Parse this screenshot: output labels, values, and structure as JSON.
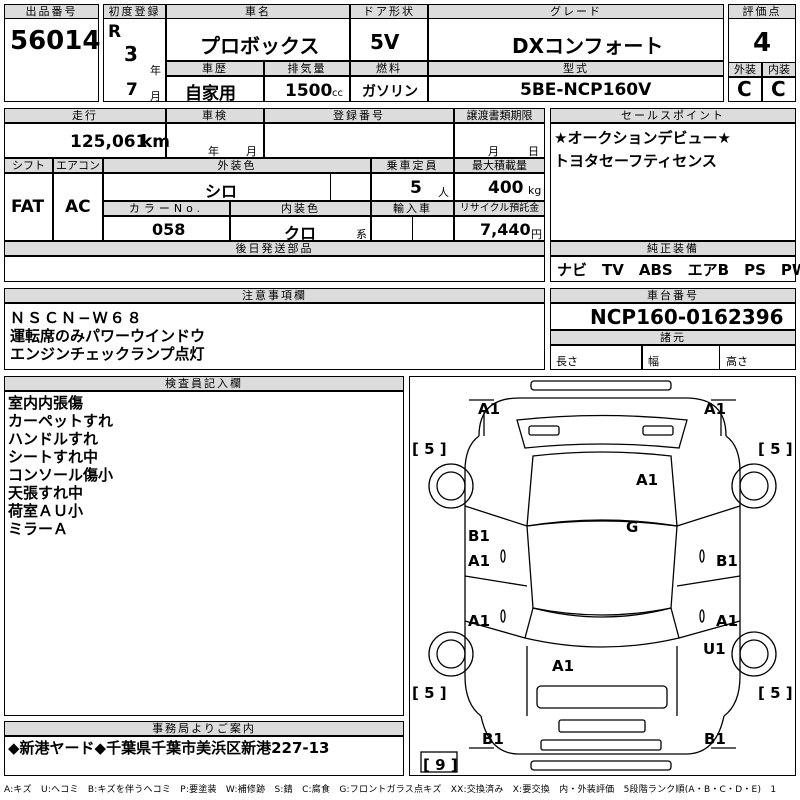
{
  "header": {
    "lot_no_label": "出品番号",
    "lot_no": "56014",
    "first_reg_label": "初度登録",
    "era": "R",
    "year": "3",
    "year_unit": "年",
    "month": "7",
    "month_unit": "月",
    "car_name_label": "車名",
    "car_name": "プロボックス",
    "door_label": "ドア形状",
    "door": "5V",
    "grade_label": "グレード",
    "grade": "DXコンフォート",
    "score_label": "評価点",
    "score": "4",
    "history_label": "車歴",
    "history": "自家用",
    "displacement_label": "排気量",
    "displacement": "1500",
    "displacement_unit": "cc",
    "fuel_label": "燃料",
    "fuel": "ガソリン",
    "model_code_label": "型式",
    "model_code": "5BE-NCP160V",
    "exterior_label": "外装",
    "interior_label": "内装",
    "exterior_grade": "C",
    "interior_grade": "C"
  },
  "row2": {
    "mileage_label": "走行",
    "mileage": "125,061",
    "mileage_unit": "km",
    "inspection_label": "車検",
    "inspection_year_unit": "年",
    "inspection_month_unit": "月",
    "reg_no_label": "登録番号",
    "transfer_label": "譲渡書類期限",
    "transfer_month_unit": "月",
    "transfer_day_unit": "日",
    "shift_label": "シフト",
    "shift": "FAT",
    "ac_label": "エアコン",
    "ac": "AC",
    "ext_color_label": "外装色",
    "ext_color": "シロ",
    "capacity_label": "乗車定員",
    "capacity": "5",
    "capacity_unit": "人",
    "max_load_label": "最大積載量",
    "max_load": "400",
    "max_load_unit": "kg",
    "color_no_label": "カラーNo.",
    "color_no": "058",
    "int_color_label": "内装色",
    "int_color": "クロ",
    "int_color_unit": "系",
    "import_label": "輸入車",
    "recycle_label": "リサイクル預託金",
    "recycle": "7,440",
    "recycle_unit": "円",
    "later_parts_label": "後日発送部品"
  },
  "sales_points": {
    "label": "セールスポイント",
    "lines": [
      "★オークションデビュー★",
      "トヨタセーフティセンス"
    ]
  },
  "equipment": {
    "label": "純正装備",
    "value": "ナビ　TV　ABS　エアB　PS　PW"
  },
  "notes": {
    "label": "注意事項欄",
    "lines": [
      "ＮＳＣＮ−Ｗ６８",
      "運転席のみパワーウインドウ",
      "エンジンチェックランプ点灯"
    ]
  },
  "chassis": {
    "label": "車台番号",
    "value": "NCP160-0162396",
    "specs_label": "諸元",
    "length_label": "長さ",
    "width_label": "幅",
    "height_label": "高さ"
  },
  "inspector": {
    "label": "検査員記入欄",
    "lines": [
      "室内内張傷",
      "カーペットすれ",
      "ハンドルすれ",
      "シートすれ中",
      "コンソール傷小",
      "天張すれ中",
      "荷室ＡＵ小",
      "ミラーＡ"
    ]
  },
  "diagram_marks": {
    "front_left": "A1",
    "front_right": "A1",
    "bonnet": "A1",
    "roof": "G",
    "left_front_door_b": "B1",
    "left_front_door_a": "A1",
    "right_front_door": "B1",
    "left_rear_door": "A1",
    "right_rear_door": "A1",
    "right_rear_fender": "U1",
    "rear": "A1",
    "rear_bumper_left": "B1",
    "rear_bumper_right": "B1",
    "tire_fl": "5",
    "tire_fr": "5",
    "tire_rl": "5",
    "tire_rr": "5",
    "spare": "9"
  },
  "office": {
    "label": "事務局よりご案内",
    "value": "◆新港ヤード◆千葉県千葉市美浜区新港227-13"
  },
  "legend": "A:キズ　U:ヘコミ　B:キズを伴うヘコミ　P:要塗装　W:補修跡　S:錆　C:腐食　G:フロントガラス点キズ　XX:交換済み　X:要交換　内・外装評価　5段階ランク順(A・B・C・D・E)　1"
}
